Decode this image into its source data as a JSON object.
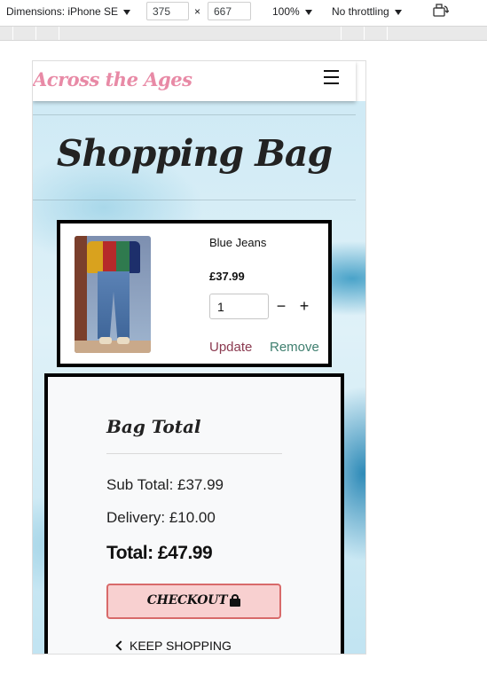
{
  "devtools": {
    "dimensions_label": "Dimensions: iPhone SE",
    "width": "375",
    "times": "×",
    "height": "667",
    "zoom": "100%",
    "throttling": "No throttling",
    "rotate_icon": "rotate-device-icon"
  },
  "navbar": {
    "brand": "Across the Ages",
    "menu_icon": "hamburger-menu-icon",
    "brand_color": "#e88aa6"
  },
  "page": {
    "title": "Shopping Bag"
  },
  "bag_item": {
    "name": "Blue Jeans",
    "price": "£37.99",
    "quantity": "1",
    "decrement": "−",
    "increment": "+",
    "update_label": "Update",
    "remove_label": "Remove",
    "update_color": "#8b3a50",
    "remove_color": "#3f7f6f"
  },
  "bag_total": {
    "heading": "Bag Total",
    "sub_total": "Sub Total: £37.99",
    "delivery": "Delivery: £10.00",
    "total": "Total: £47.99",
    "checkout_label": "CHECKOUT",
    "checkout_icon": "lock-icon",
    "keep_shopping_label": "KEEP SHOPPING",
    "keep_shopping_icon": "chevron-left-icon",
    "checkout_bg": "#f8d0d0",
    "checkout_border": "#d86a6a"
  }
}
